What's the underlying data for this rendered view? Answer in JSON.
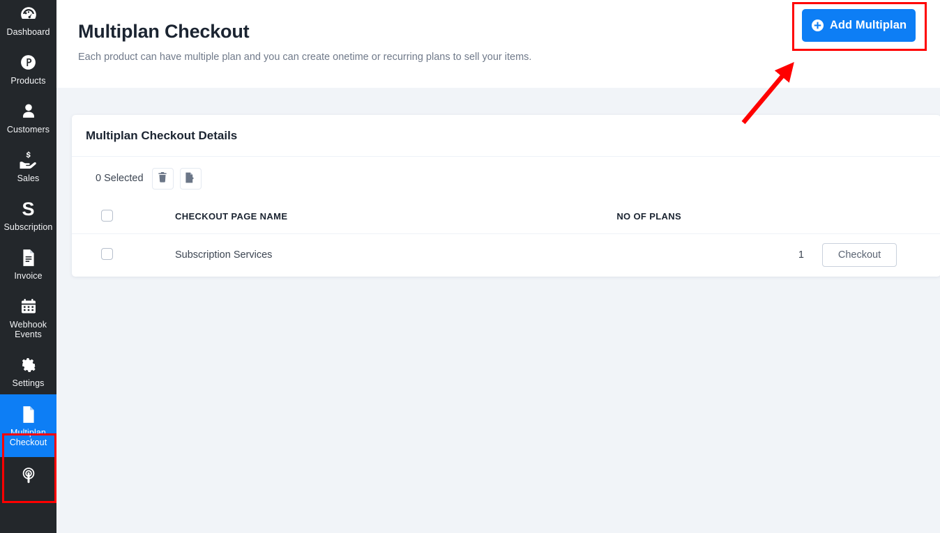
{
  "sidebar": {
    "items": [
      {
        "label": "Dashboard",
        "icon": "dashboard-icon",
        "active": false
      },
      {
        "label": "Products",
        "icon": "products-icon",
        "active": false
      },
      {
        "label": "Customers",
        "icon": "customers-icon",
        "active": false
      },
      {
        "label": "Sales",
        "icon": "sales-icon",
        "active": false
      },
      {
        "label": "Subscription",
        "icon": "subscription-icon",
        "active": false
      },
      {
        "label": "Invoice",
        "icon": "invoice-icon",
        "active": false
      },
      {
        "label": "Webhook Events",
        "icon": "webhook-events-icon",
        "active": false
      },
      {
        "label": "Settings",
        "icon": "settings-gear-icon",
        "active": false
      },
      {
        "label": "Multiplan Checkout",
        "icon": "multiplan-checkout-icon",
        "active": true
      },
      {
        "label": "",
        "icon": "broadcast-icon",
        "active": false
      }
    ]
  },
  "header": {
    "title": "Multiplan Checkout",
    "subtitle": "Each product can have multiple plan and you can create onetime or recurring plans to sell your items.",
    "add_button_label": "Add Multiplan",
    "add_button_icon": "plus-circle-icon"
  },
  "card": {
    "title": "Multiplan Checkout Details",
    "toolbar": {
      "selected_text": "0 Selected",
      "delete_icon": "trash-icon",
      "export_icon": "export-file-icon"
    },
    "table": {
      "columns": [
        "",
        "CHECKOUT PAGE NAME",
        "NO OF PLANS",
        ""
      ],
      "rows": [
        {
          "selected": false,
          "checkout_page_name": "Subscription Services",
          "no_of_plans": "1",
          "action_label": "Checkout"
        }
      ]
    }
  },
  "annotations": {
    "button_highlight_color": "#ff0000",
    "sidebar_highlight_color": "#ff0000",
    "arrow_color": "#ff0000"
  },
  "colors": {
    "accent": "#0d7ef5",
    "sidebar_bg": "#23272b",
    "page_bg": "#f1f4f8",
    "card_bg": "#ffffff",
    "text_primary": "#1b2431",
    "text_muted": "#707a8a"
  }
}
